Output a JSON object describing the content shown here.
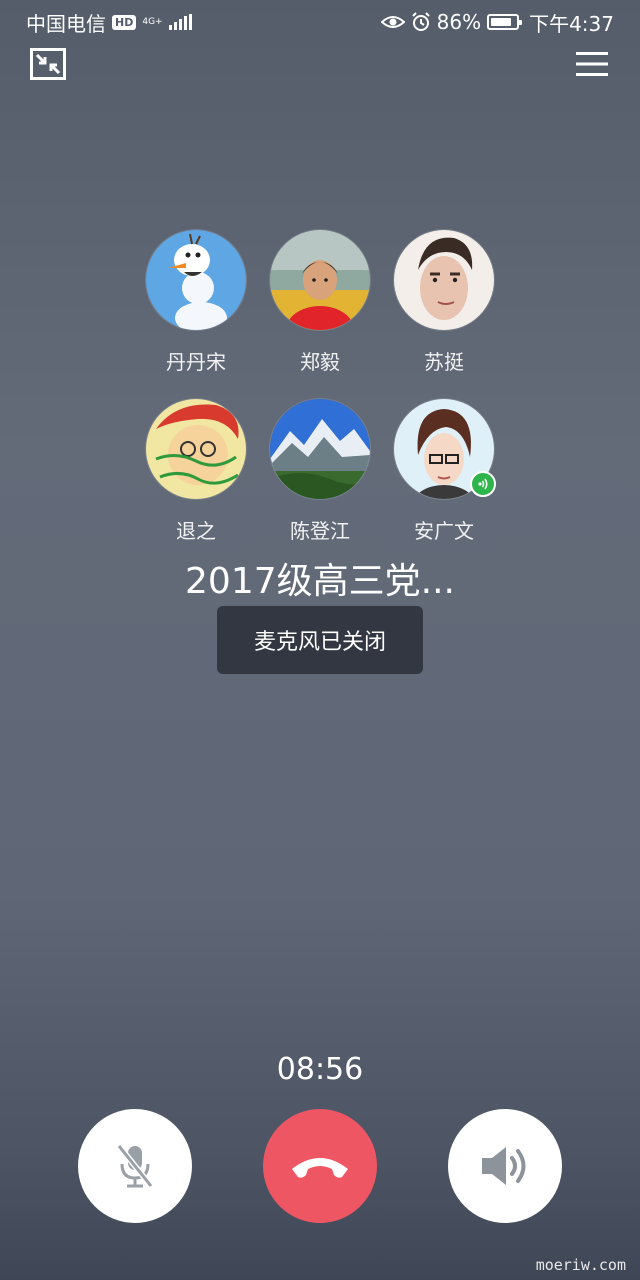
{
  "status_bar": {
    "carrier": "中国电信",
    "hd": "HD",
    "network": "4G+",
    "battery_percent": "86%",
    "time": "下午4:37"
  },
  "top_controls": {
    "minimize_icon": "shrink-arrows-icon",
    "menu_icon": "hamburger-menu-icon"
  },
  "members": [
    {
      "name": "丹丹宋"
    },
    {
      "name": "郑毅"
    },
    {
      "name": "苏挺"
    },
    {
      "name": "退之"
    },
    {
      "name": "陈登江"
    },
    {
      "name": "安广文",
      "speaking": true
    }
  ],
  "group_name": "2017级高三党...",
  "toast": "麦克风已关闭",
  "call_timer": "08:56",
  "controls": {
    "mute": "microphone-muted-icon",
    "hangup": "phone-hangup-icon",
    "speaker": "speaker-icon"
  },
  "watermark": "moeriw.com",
  "colors": {
    "hangup": "#ef5663",
    "speaking": "#2db44a"
  }
}
